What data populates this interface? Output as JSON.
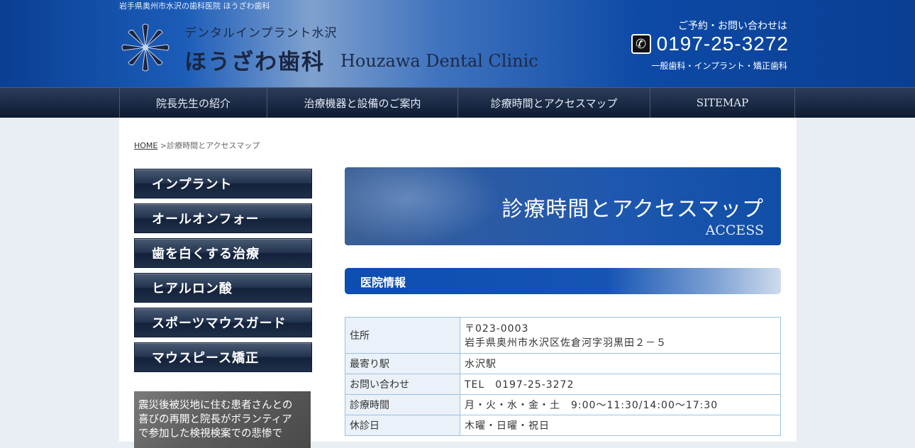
{
  "header": {
    "tagline": "岩手県奥州市水沢の歯科医院 ほうざわ歯科",
    "logo_sub": "デンタルインプラント水沢",
    "logo_main": "ほうざわ歯科",
    "logo_en": "Houzawa Dental Clinic",
    "contact_note": "ご予約・お問い合わせは",
    "phone": "0197-25-3272",
    "services": "一般歯科・インプラント・矯正歯科"
  },
  "nav": [
    {
      "label": "院長先生の紹介"
    },
    {
      "label": "治療機器と設備のご案内"
    },
    {
      "label": "診療時間とアクセスマップ"
    },
    {
      "label": "SITEMAP"
    }
  ],
  "breadcrumb": {
    "home": "HOME",
    "separator": " >",
    "current": "診療時間とアクセスマップ"
  },
  "side_menu": [
    {
      "label": "インプラント"
    },
    {
      "label": "オールオンフォー"
    },
    {
      "label": "歯を白くする治療"
    },
    {
      "label": "ヒアルロン酸"
    },
    {
      "label": "スポーツマウスガード"
    },
    {
      "label": "マウスピース矯正"
    }
  ],
  "side_banner": {
    "lines": [
      "震災後被災地に住む患者さんとの",
      "喜びの再開と院長がボランティア",
      "で参加した検視検案での悲惨で"
    ]
  },
  "page_banner": {
    "title": "診療時間とアクセスマップ",
    "subtitle": "ACCESS"
  },
  "section": {
    "heading": "医院情報"
  },
  "info_table": [
    {
      "label": "住所",
      "value_line1": "〒023-0003",
      "value_line2": "岩手県奥州市水沢区佐倉河字羽黒田２－５"
    },
    {
      "label": "最寄り駅",
      "value": "水沢駅"
    },
    {
      "label": "お問い合わせ",
      "value": "TEL　0197-25-3272"
    },
    {
      "label": "診療時間",
      "value": "月・火・水・金・土　9:00〜11:30/14:00〜17:30"
    },
    {
      "label": "休診日",
      "value": "木曜・日曜・祝日"
    }
  ],
  "colors": {
    "header_blue": "#0a3f93",
    "nav_dark": "#1a2a45",
    "table_border": "#9cc1e0",
    "table_label_bg": "#eaf1f8"
  },
  "icons": {
    "logo": "leaf-fan-logo-icon",
    "phone": "phone-icon"
  }
}
